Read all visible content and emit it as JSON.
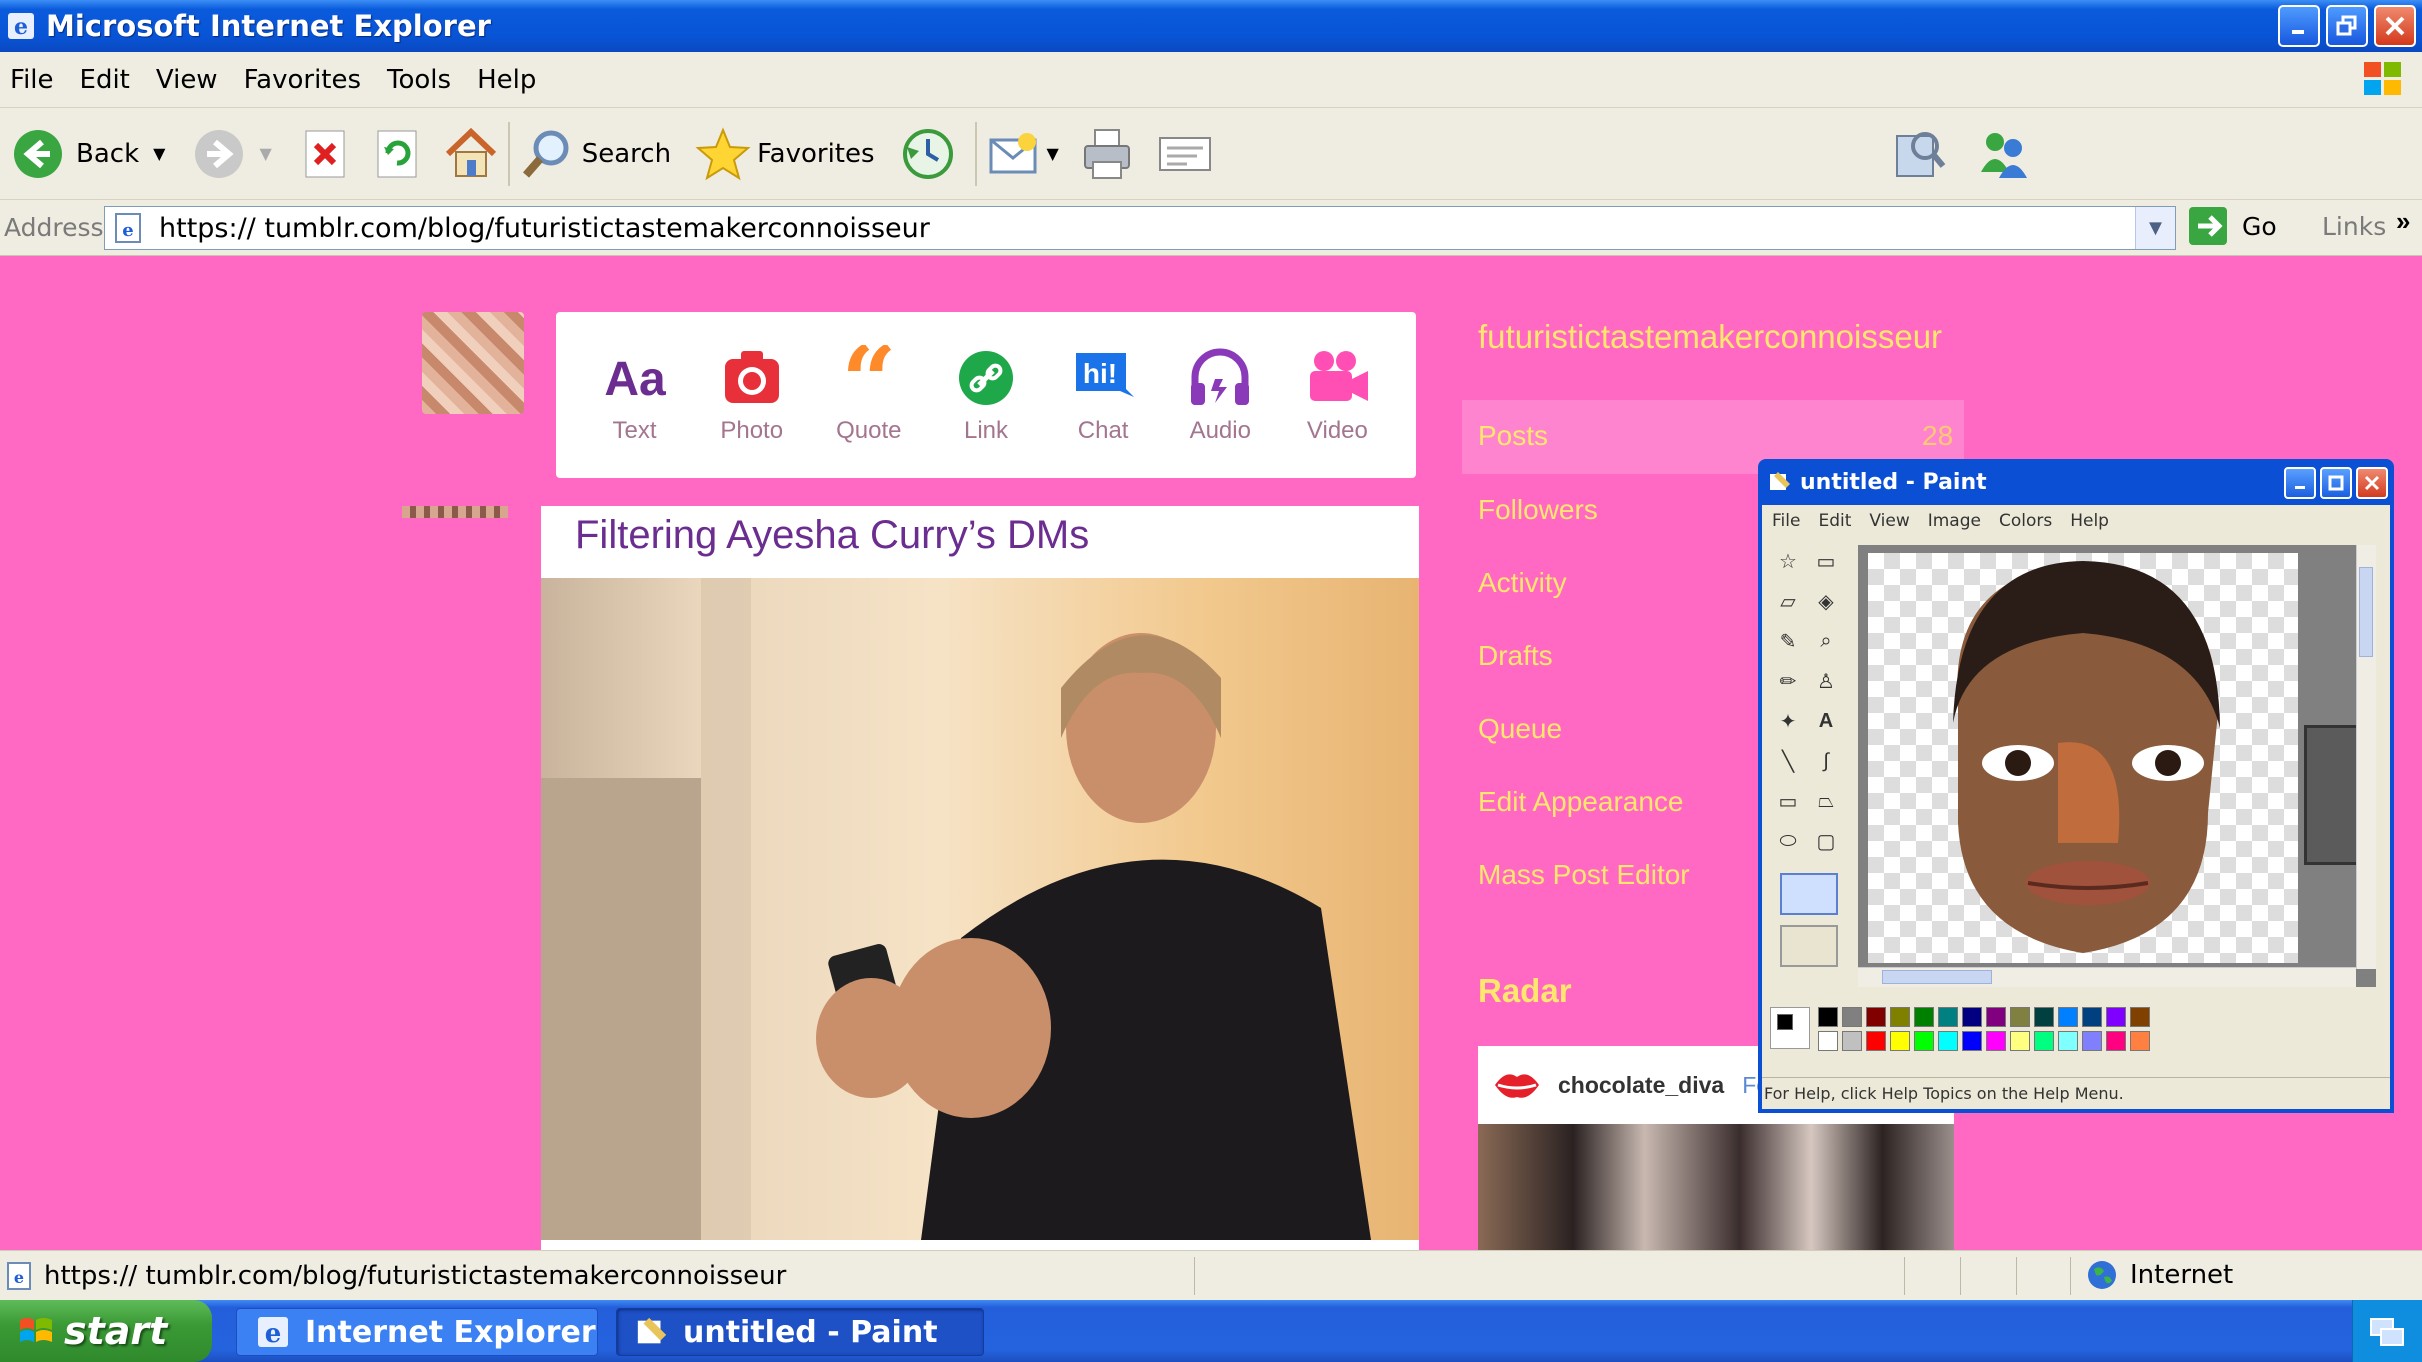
{
  "browser": {
    "title": "Microsoft Internet Explorer",
    "menu": [
      "File",
      "Edit",
      "View",
      "Favorites",
      "Tools",
      "Help"
    ],
    "toolbar": {
      "back": "Back",
      "search": "Search",
      "favorites": "Favorites"
    },
    "address_label": "Address",
    "url": "https:// tumblr.com/blog/futuristictastemakerconnoisseur",
    "go": "Go",
    "links": "Links",
    "status_url": "https:// tumblr.com/blog/futuristictastemakerconnoisseur",
    "zone": "Internet"
  },
  "tumblr": {
    "post_types": [
      {
        "label": "Text",
        "icon": "text-icon",
        "color": "#6b2d8f"
      },
      {
        "label": "Photo",
        "icon": "camera-icon",
        "color": "#e8303b"
      },
      {
        "label": "Quote",
        "icon": "quote-icon",
        "color": "#ff8a2a"
      },
      {
        "label": "Link",
        "icon": "link-icon",
        "color": "#1ea84a"
      },
      {
        "label": "Chat",
        "icon": "chat-icon",
        "color": "#1a73e8"
      },
      {
        "label": "Audio",
        "icon": "headphones-icon",
        "color": "#8a3ab9"
      },
      {
        "label": "Video",
        "icon": "video-camera-icon",
        "color": "#ff4fb4"
      }
    ],
    "post_title": "Filtering Ayesha Curry’s DMs",
    "blog_name": "futuristictastemakerconnoisseur",
    "nav": [
      {
        "label": "Posts",
        "count": "28"
      },
      {
        "label": "Followers"
      },
      {
        "label": "Activity"
      },
      {
        "label": "Drafts"
      },
      {
        "label": "Queue"
      },
      {
        "label": "Edit Appearance"
      },
      {
        "label": "Mass Post Editor"
      }
    ],
    "radar_title": "Radar",
    "radar_user": "chocolate_diva",
    "radar_follow": "Fo"
  },
  "paint": {
    "title": "untitled - Paint",
    "menu": [
      "File",
      "Edit",
      "View",
      "Image",
      "Colors",
      "Help"
    ],
    "status": "For Help, click Help Topics on the Help Menu.",
    "palette_top": [
      "#000000",
      "#808080",
      "#800000",
      "#808000",
      "#008000",
      "#008080",
      "#000080",
      "#800080",
      "#808040",
      "#004040",
      "#0080ff",
      "#004080",
      "#8000ff",
      "#804000"
    ],
    "palette_bottom": [
      "#ffffff",
      "#c0c0c0",
      "#ff0000",
      "#ffff00",
      "#00ff00",
      "#00ffff",
      "#0000ff",
      "#ff00ff",
      "#ffff80",
      "#00ff80",
      "#80ffff",
      "#8080ff",
      "#ff0080",
      "#ff8040"
    ]
  },
  "taskbar": {
    "start": "start",
    "tasks": [
      "Internet Explorer",
      "untitled - Paint"
    ]
  },
  "colors": {
    "page_bg": "#ff69c4",
    "accent_text": "#ffe76d",
    "xp_blue": "#0a5bdc"
  }
}
